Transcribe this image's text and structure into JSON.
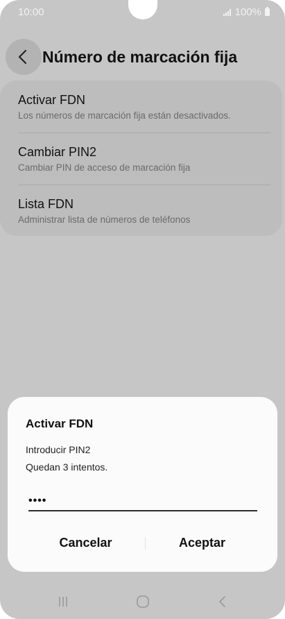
{
  "status_bar": {
    "time": "10:00",
    "battery": "100%"
  },
  "header": {
    "title": "Número de marcación fija"
  },
  "settings": {
    "items": [
      {
        "title": "Activar FDN",
        "subtitle": "Los números de marcación fija están desactivados."
      },
      {
        "title": "Cambiar PIN2",
        "subtitle": "Cambiar PIN de acceso de marcación fija"
      },
      {
        "title": "Lista FDN",
        "subtitle": "Administrar lista de números de teléfonos"
      }
    ]
  },
  "dialog": {
    "title": "Activar FDN",
    "prompt": "Introducir PIN2",
    "attempts": "Quedan 3 intentos.",
    "pin_value": "••••",
    "cancel_label": "Cancelar",
    "accept_label": "Aceptar"
  },
  "icons": {
    "back": "chevron-left-icon",
    "recents": "recents-icon",
    "home": "home-icon",
    "nav_back": "back-icon"
  }
}
